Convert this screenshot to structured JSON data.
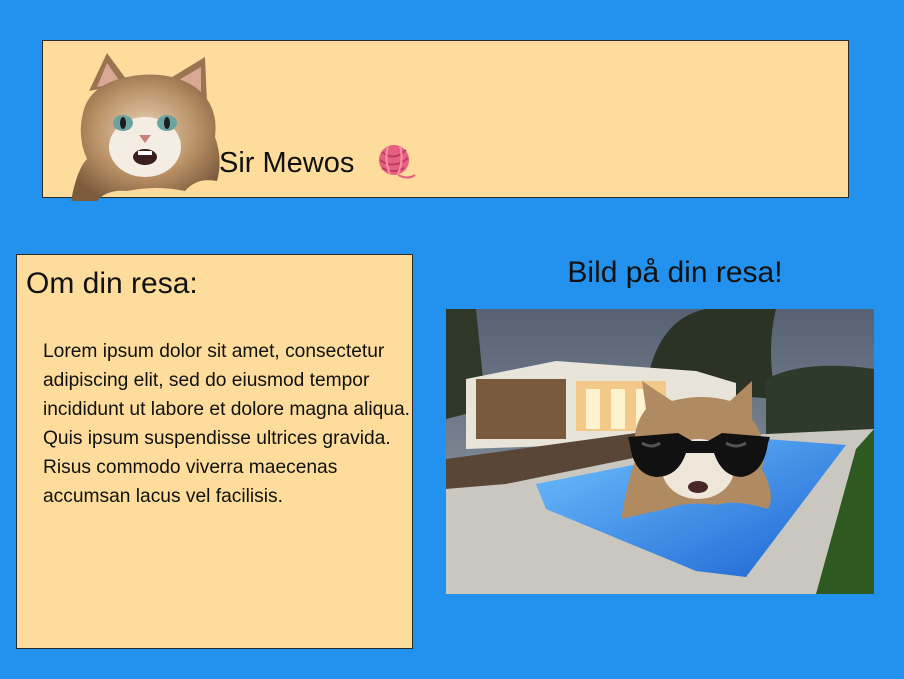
{
  "header": {
    "title": "Sir Mewos",
    "logo_icon": "kitten-face-icon",
    "yarn_icon": "yarn-ball-icon",
    "yarn_color": "#e8607f"
  },
  "about": {
    "heading": "Om din resa:",
    "body": "Lorem ipsum dolor sit amet, consectetur adipiscing elit, sed do eiusmod tempor incididunt ut labore et dolore magna aliqua. Quis ipsum suspendisse ultrices gravida. Risus commodo viverra maecenas accumsan lacus vel facilisis."
  },
  "photo_section": {
    "heading": "Bild på din resa!",
    "image_icon": "pool-house-cat-sunglasses-photo"
  },
  "colors": {
    "background": "#2392ee",
    "panel": "#fddc9c",
    "border": "#2b2b2b"
  }
}
